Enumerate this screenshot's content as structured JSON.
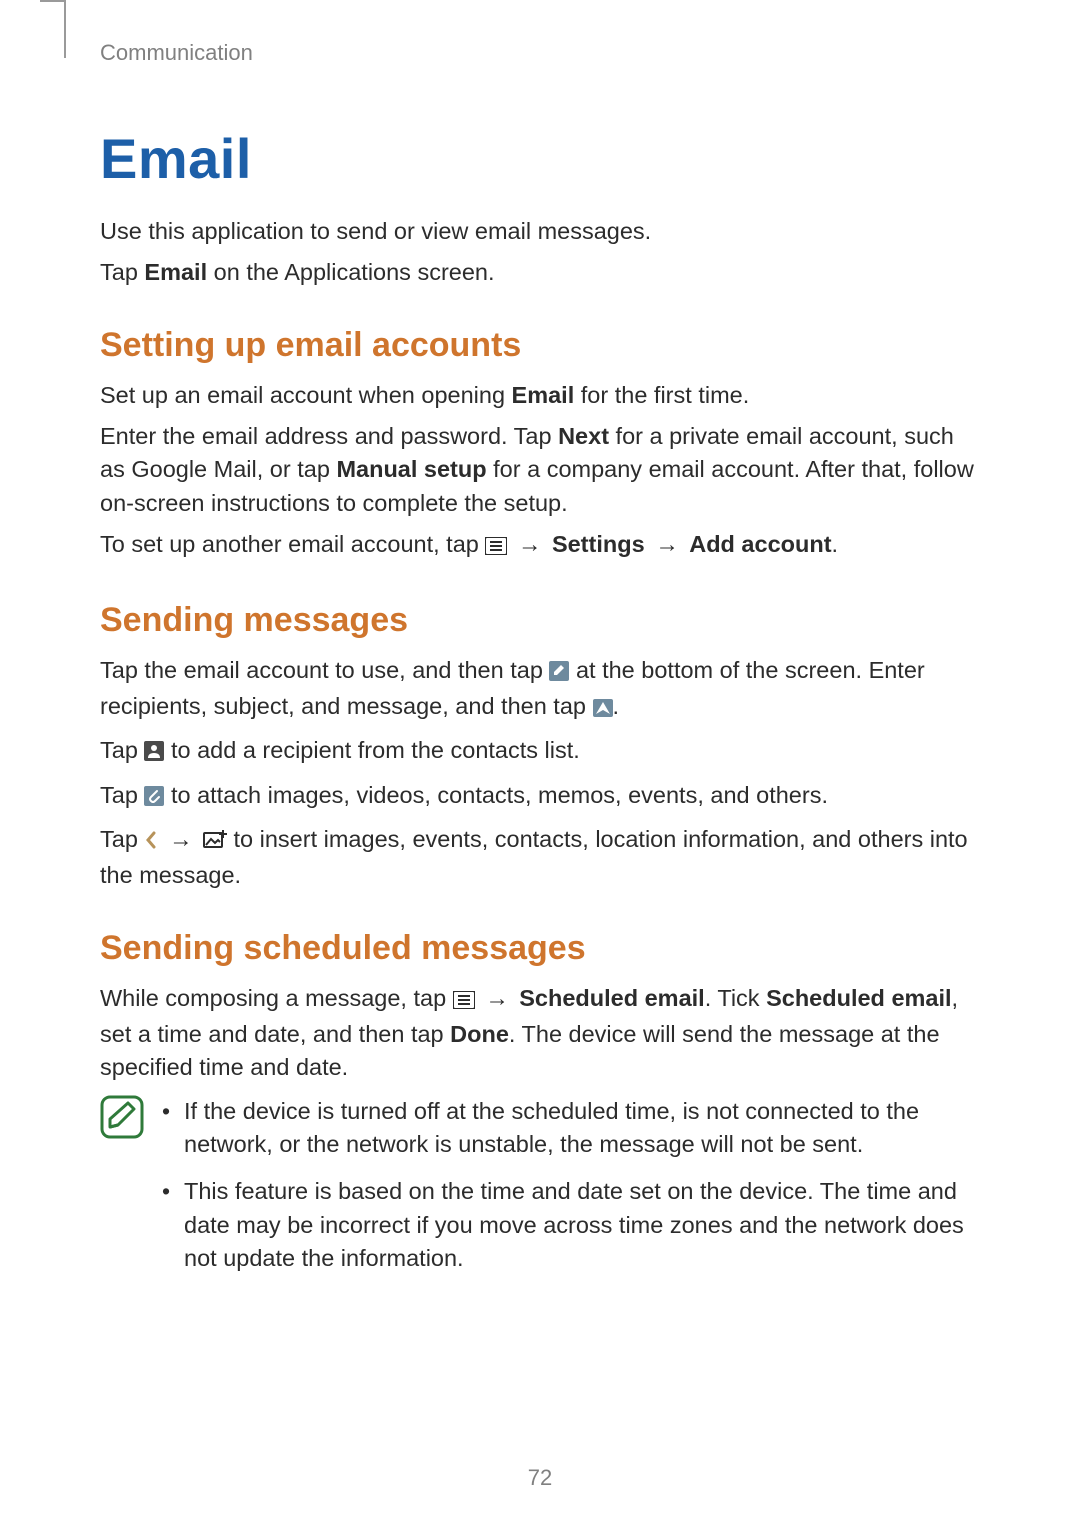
{
  "header": {
    "section": "Communication"
  },
  "title": "Email",
  "intro": {
    "p1": "Use this application to send or view email messages.",
    "p2_pre": "Tap ",
    "p2_bold": "Email",
    "p2_post": " on the Applications screen."
  },
  "setup": {
    "heading": "Setting up email accounts",
    "p1_pre": "Set up an email account when opening ",
    "p1_bold": "Email",
    "p1_post": " for the first time.",
    "p2_a": "Enter the email address and password. Tap ",
    "p2_b": "Next",
    "p2_c": " for a private email account, such as Google Mail, or tap ",
    "p2_d": "Manual setup",
    "p2_e": " for a company email account. After that, follow on-screen instructions to complete the setup.",
    "p3_a": "To set up another email account, tap ",
    "arrow": "→",
    "p3_b": "Settings",
    "p3_c": "Add account",
    "period": "."
  },
  "sending": {
    "heading": "Sending messages",
    "p1_a": "Tap the email account to use, and then tap ",
    "p1_b": " at the bottom of the screen. Enter recipients, subject, and message, and then tap ",
    "p1_c": ".",
    "p2_a": "Tap ",
    "p2_b": " to add a recipient from the contacts list.",
    "p3_a": "Tap ",
    "p3_b": " to attach images, videos, contacts, memos, events, and others.",
    "p4_a": "Tap ",
    "p4_b": " to insert images, events, contacts, location information, and others into the message."
  },
  "scheduled": {
    "heading": "Sending scheduled messages",
    "p1_a": "While composing a message, tap ",
    "p1_b": "Scheduled email",
    "p1_c": ". Tick ",
    "p1_d": "Scheduled email",
    "p1_e": ", set a time and date, and then tap ",
    "p1_f": "Done",
    "p1_g": ". The device will send the message at the specified time and date.",
    "note1": "If the device is turned off at the scheduled time, is not connected to the network, or the network is unstable, the message will not be sent.",
    "note2": "This feature is based on the time and date set on the device. The time and date may be incorrect if you move across time zones and the network does not update the information."
  },
  "page_number": "72"
}
